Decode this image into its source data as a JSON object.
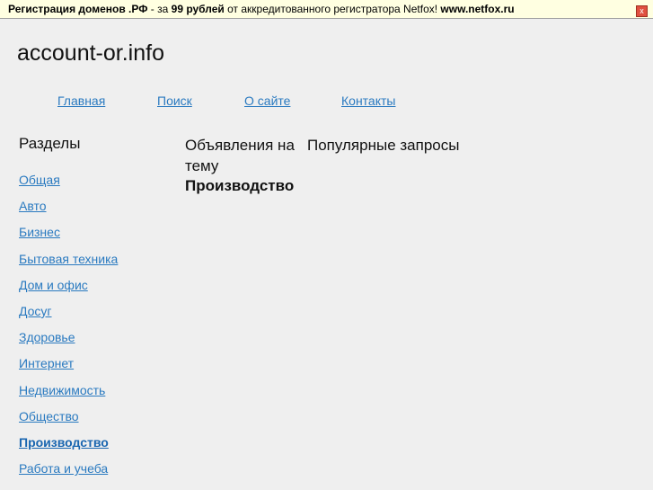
{
  "banner": {
    "part1": "Регистрация доменов .РФ",
    "part2": " - за ",
    "part3": "99 рублей",
    "part4": " от аккредитованного регистратора Netfox! ",
    "part5": "www.netfox.ru",
    "close": "x"
  },
  "site_title": "account-or.info",
  "nav": [
    "Главная",
    "Поиск",
    "О сайте",
    "Контакты"
  ],
  "sidebar": {
    "title": "Разделы",
    "items": [
      "Общая",
      "Авто",
      "Бизнес",
      "Бытовая техника",
      "Дом и офис",
      "Досуг",
      "Здоровье",
      "Интернет",
      "Недвижимость",
      "Общество",
      "Производство",
      "Работа и учеба"
    ]
  },
  "main": {
    "col1": "Объявления на тему",
    "col2": "Популярные запросы",
    "subtitle": "Производство"
  }
}
